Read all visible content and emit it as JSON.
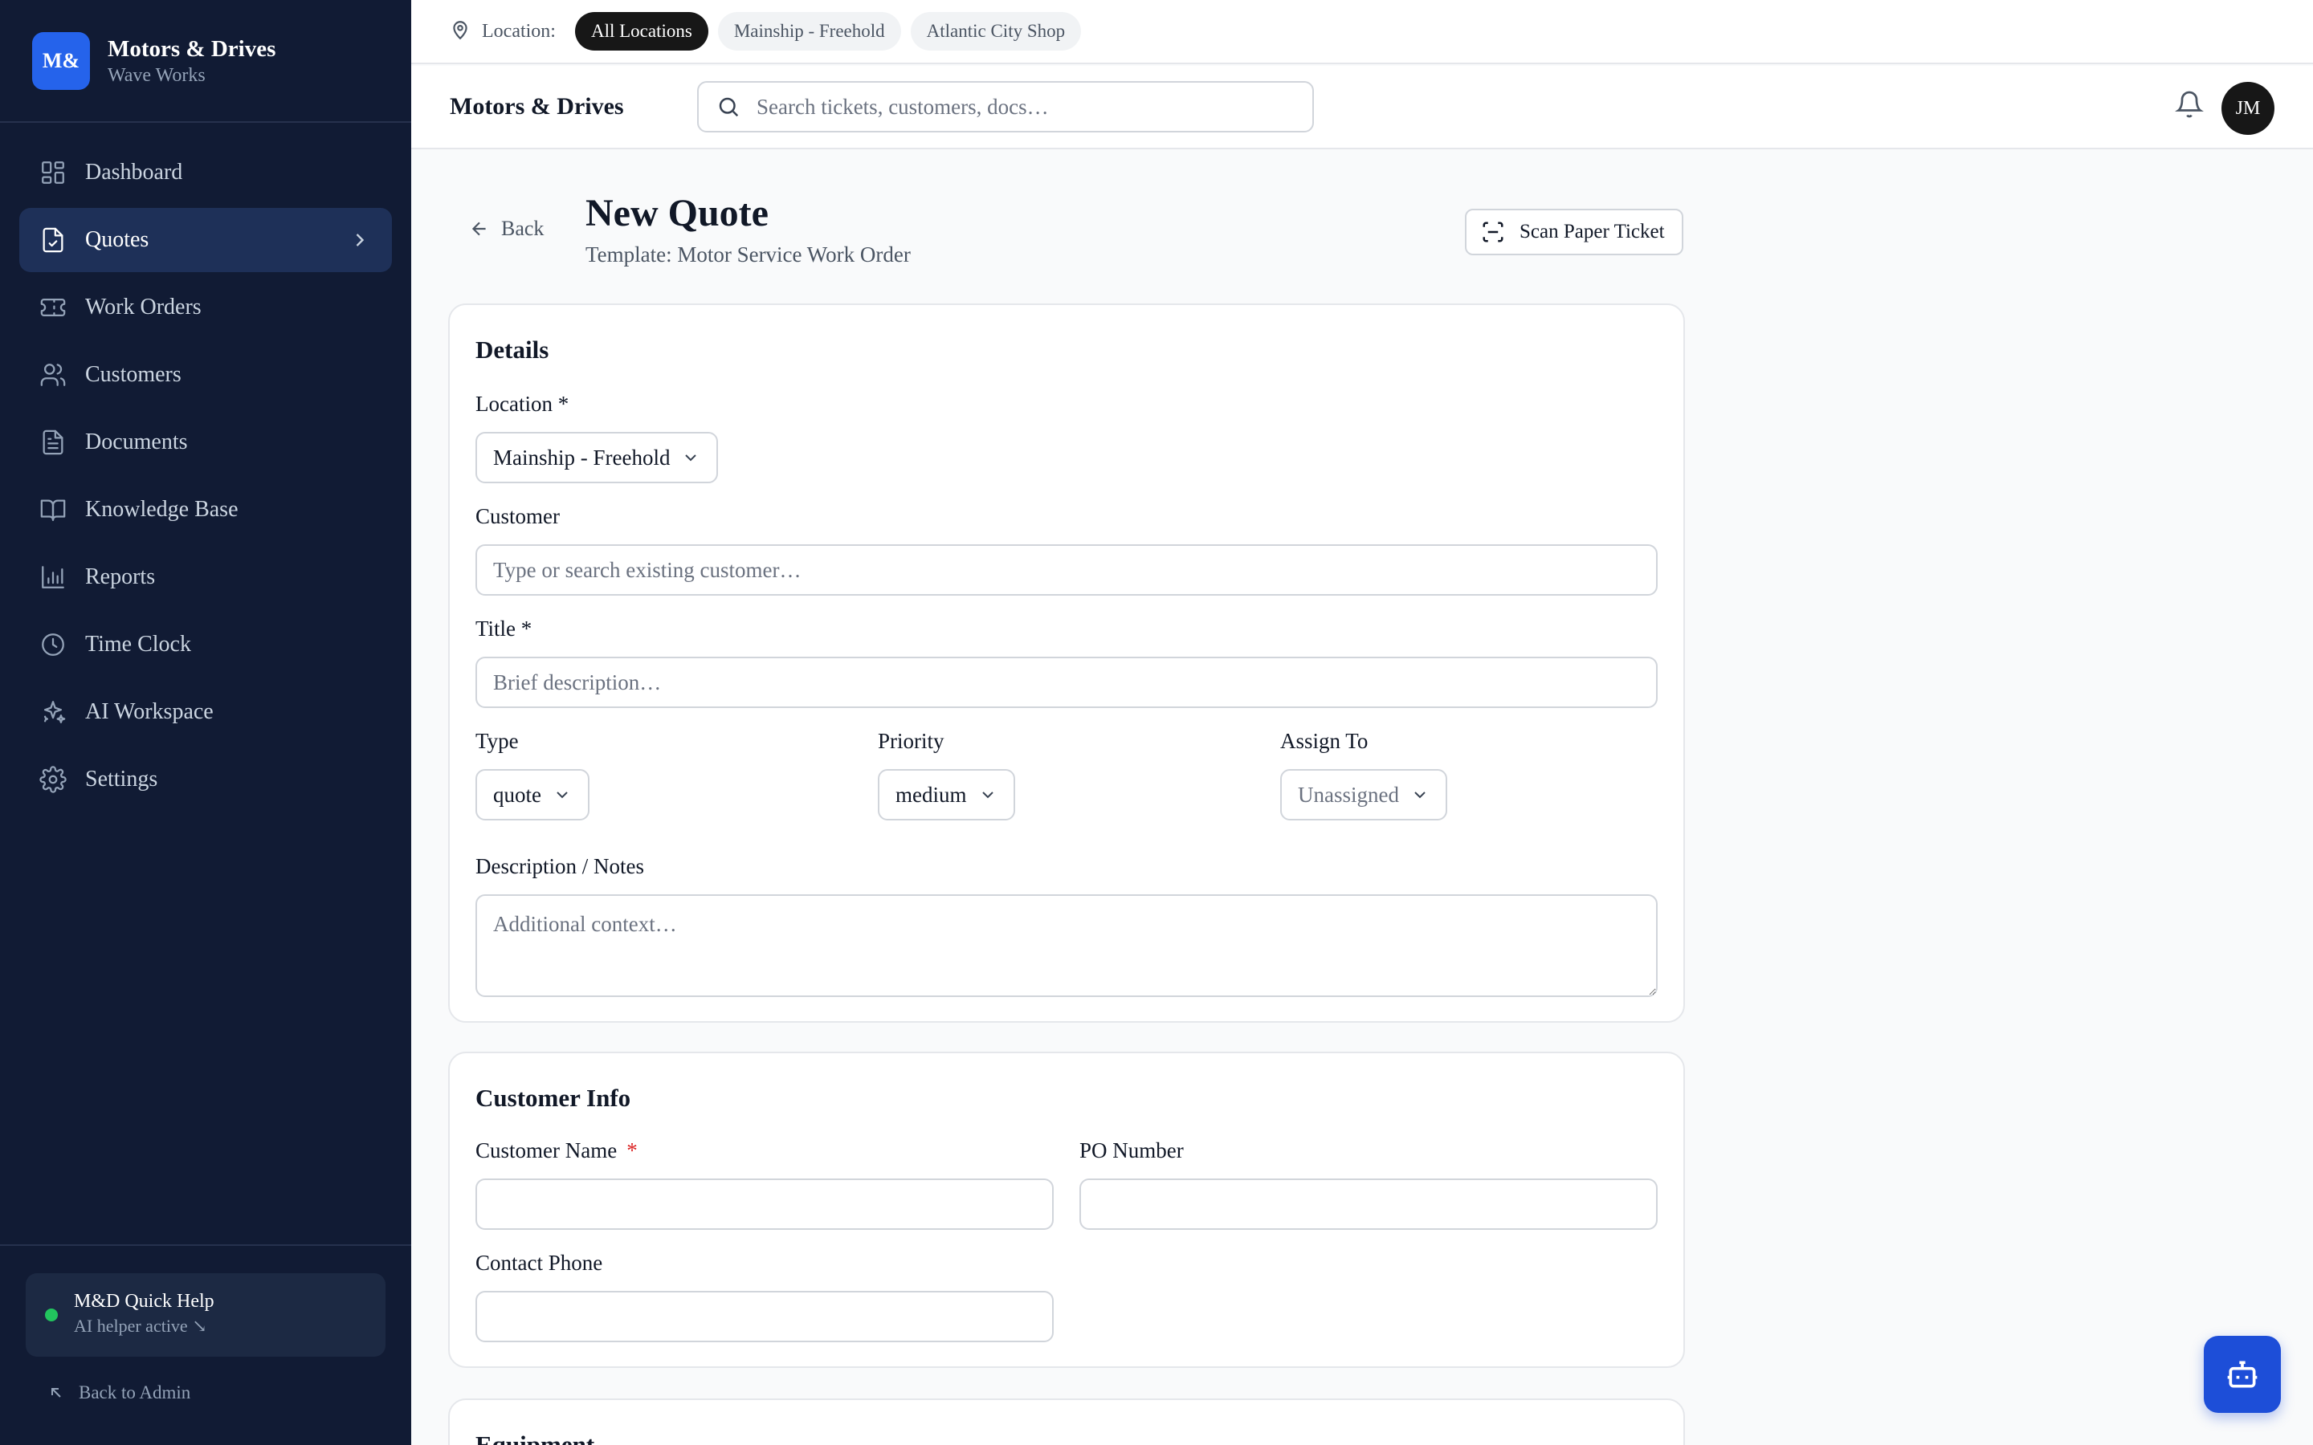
{
  "brand": {
    "logo": "M&",
    "name": "Motors & Drives",
    "subtitle": "Wave Works"
  },
  "sidebar": {
    "items": [
      {
        "label": "Dashboard",
        "icon": "grid-icon"
      },
      {
        "label": "Quotes",
        "icon": "file-check-icon",
        "active": true
      },
      {
        "label": "Work Orders",
        "icon": "ticket-icon"
      },
      {
        "label": "Customers",
        "icon": "users-icon"
      },
      {
        "label": "Documents",
        "icon": "document-icon"
      },
      {
        "label": "Knowledge Base",
        "icon": "book-icon"
      },
      {
        "label": "Reports",
        "icon": "bar-chart-icon"
      },
      {
        "label": "Time Clock",
        "icon": "clock-icon"
      },
      {
        "label": "AI Workspace",
        "icon": "sparkles-icon"
      },
      {
        "label": "Settings",
        "icon": "gear-icon"
      }
    ],
    "help": {
      "title": "M&D Quick Help",
      "status": "AI helper active ↘"
    },
    "back_admin": "Back to Admin"
  },
  "locbar": {
    "label": "Location:",
    "chips": [
      "All Locations",
      "Mainship - Freehold",
      "Atlantic City Shop"
    ],
    "active_chip": "All Locations"
  },
  "header": {
    "title": "Motors & Drives",
    "search_placeholder": "Search tickets, customers, docs…",
    "avatar_initials": "JM"
  },
  "page": {
    "back_label": "Back",
    "title": "New Quote",
    "subtitle": "Template: Motor Service Work Order",
    "scan_label": "Scan Paper Ticket"
  },
  "details": {
    "heading": "Details",
    "location_label": "Location *",
    "location_value": "Mainship - Freehold",
    "customer_label": "Customer",
    "customer_placeholder": "Type or search existing customer…",
    "title_label": "Title *",
    "title_placeholder": "Brief description…",
    "type_label": "Type",
    "type_value": "quote",
    "priority_label": "Priority",
    "priority_value": "medium",
    "assign_label": "Assign To",
    "assign_value": "Unassigned",
    "notes_label": "Description / Notes",
    "notes_placeholder": "Additional context…"
  },
  "customer_info": {
    "heading": "Customer Info",
    "name_label": "Customer Name",
    "required_mark": "*",
    "po_label": "PO Number",
    "phone_label": "Contact Phone"
  },
  "equipment": {
    "heading": "Equipment"
  },
  "colors": {
    "sidebar_bg": "#111b34",
    "accent": "#2563eb",
    "active_nav": "#1e3058",
    "status_dot": "#22c55e"
  }
}
